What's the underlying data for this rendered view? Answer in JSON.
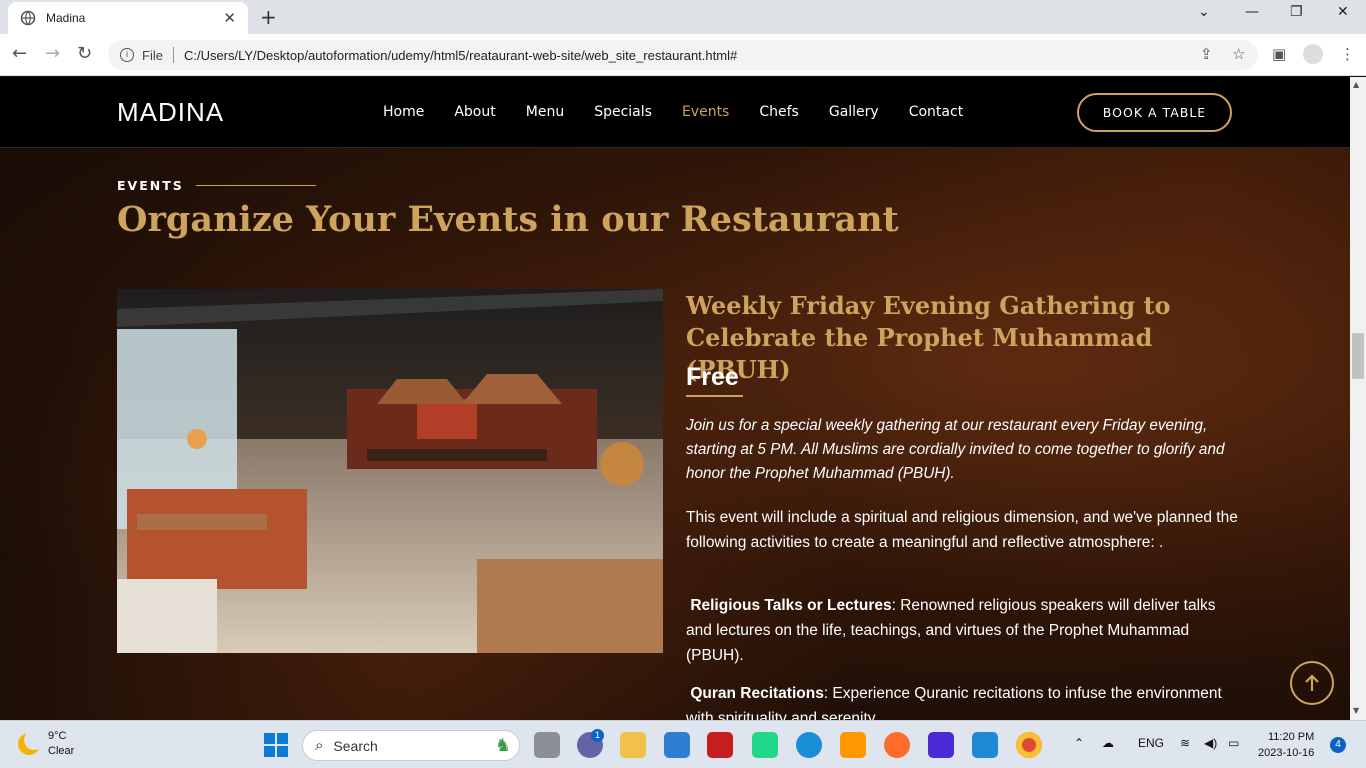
{
  "browser": {
    "tab_title": "Madina",
    "new_tab": "+",
    "file_label": "File",
    "url": "C:/Users/LY/Desktop/autoformation/udemy/html5/reataurant-web-site/web_site_restaurant.html#"
  },
  "site": {
    "logo": "MADINA",
    "nav": [
      {
        "label": "Home"
      },
      {
        "label": "About"
      },
      {
        "label": "Menu"
      },
      {
        "label": "Specials"
      },
      {
        "label": "Events"
      },
      {
        "label": "Chefs"
      },
      {
        "label": "Gallery"
      },
      {
        "label": "Contact"
      }
    ],
    "book_label": "BOOK A TABLE"
  },
  "events": {
    "label": "EVENTS",
    "heading": "Organize Your Events in our Restaurant",
    "event_title": "Weekly Friday Evening Gathering to Celebrate the Prophet Muhammad (PBUH)",
    "price": "Free",
    "intro": "Join us for a special weekly gathering at our restaurant every Friday evening, starting at 5 PM. All Muslims are cordially invited to come together to glorify and honor the Prophet Muhammad (PBUH).",
    "para1": " This event will include a spiritual and religious dimension, and we've planned the following activities to create a meaningful and reflective atmosphere: .",
    "item1_title": "Religious Talks or Lectures",
    "item1_text": ": Renowned religious speakers will deliver talks and lectures on the life, teachings, and virtues of the Prophet Muhammad (PBUH).",
    "item2_title": "Quran Recitations",
    "item2_text": ": Experience Quranic recitations to infuse the environment with spirituality and serenity."
  },
  "taskbar": {
    "temp": "9°C",
    "condition": "Clear",
    "search": "Search",
    "lang": "ENG",
    "time": "11:20 PM",
    "date": "2023-10-16",
    "notifications": "4",
    "teams_badge": "1"
  },
  "colors": {
    "accent": "#cda45e",
    "nav_bg": "#000000"
  }
}
